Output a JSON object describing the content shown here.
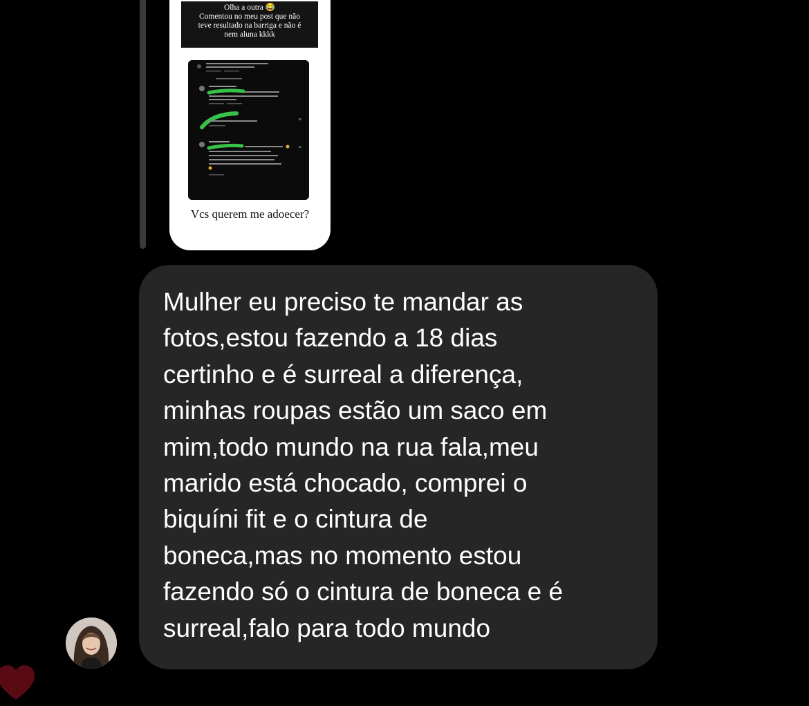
{
  "story_reply": {
    "caption_lines": [
      "Olha a outra 😂",
      "Comentou no meu post que não",
      "teve resultado na barriga e não é",
      "nem aluna kkkk"
    ],
    "bottom_text": "Vcs querem me adoecer?"
  },
  "message": {
    "text": "Mulher eu preciso te mandar as\nfotos,estou fazendo a 18 dias\ncertinho e é surreal a diferença,\nminhas roupas estão um saco em\nmim,todo mundo na rua fala,meu\nmarido está chocado, comprei o\nbiquíni fit e o cintura de\nboneca,mas no momento estou\nfazendo só o cintura de boneca e é\nsurreal,falo para todo mundo"
  },
  "icons": {
    "avatar": "sender-avatar",
    "reaction": "heart-icon"
  },
  "colors": {
    "background": "#000000",
    "bubble": "#262626",
    "text": "#ffffff",
    "heart": "#5a0a12",
    "highlight": "#38c24a"
  }
}
